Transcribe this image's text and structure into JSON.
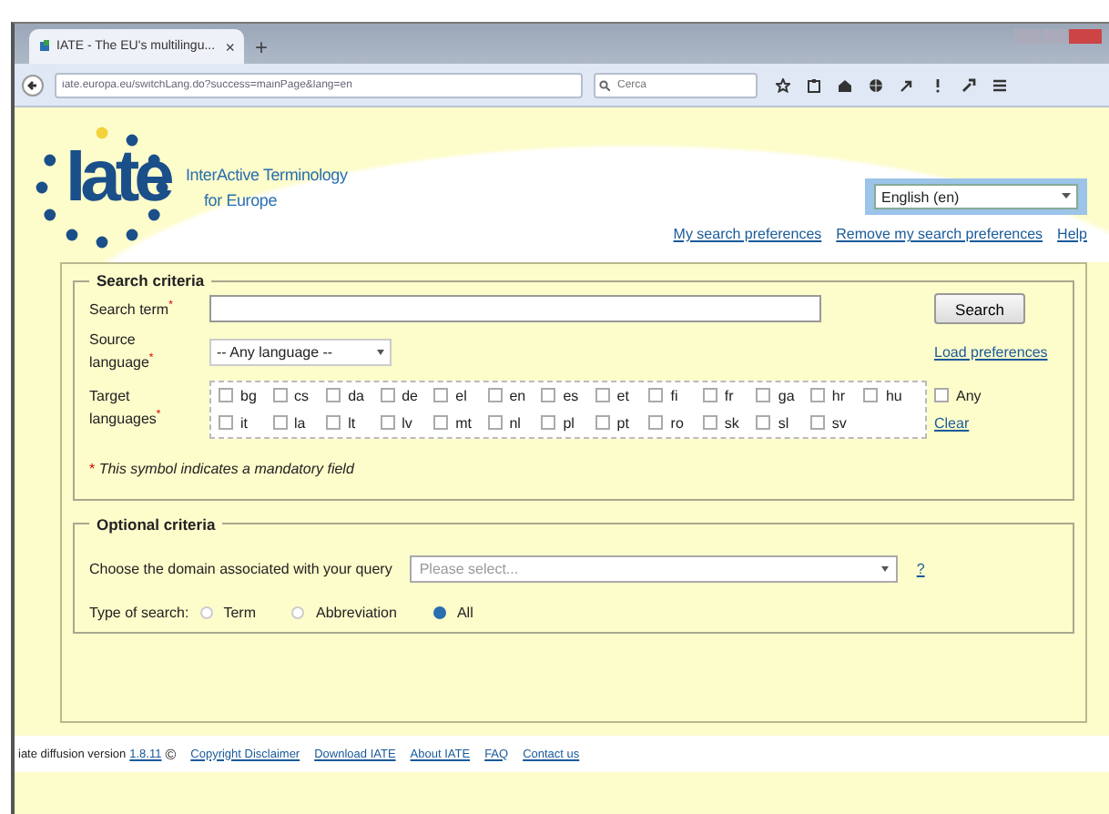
{
  "browser": {
    "tab_title": "IATE - The EU's multilingu...",
    "tab_close": "×",
    "new_tab": "+",
    "url": "iate.europa.eu/switchLang.do?success=mainPage&lang=en",
    "search_placeholder": "Cerca"
  },
  "header": {
    "logo_text": "Iate",
    "tagline_1": "InterActive Terminology",
    "tagline_2": "for Europe",
    "language": "English (en)",
    "links": [
      "My search preferences",
      "Remove my search preferences",
      "Help"
    ]
  },
  "search": {
    "legend": "Search criteria",
    "term_label": "Search term",
    "required_mark": "*",
    "search_button": "Search",
    "source_label": "Source language",
    "source_value": "-- Any language --",
    "load_link": "Load preferences",
    "target_label": "Target languages",
    "languages": [
      {
        "code": "bg",
        "checked": false
      },
      {
        "code": "cs",
        "checked": false
      },
      {
        "code": "da",
        "checked": false
      },
      {
        "code": "de",
        "checked": false
      },
      {
        "code": "el",
        "checked": false
      },
      {
        "code": "en",
        "checked": false
      },
      {
        "code": "es",
        "checked": false
      },
      {
        "code": "et",
        "checked": false
      },
      {
        "code": "fi",
        "checked": false
      },
      {
        "code": "fr",
        "checked": false
      },
      {
        "code": "ga",
        "checked": false
      },
      {
        "code": "hr",
        "checked": false
      },
      {
        "code": "hu",
        "checked": false
      },
      {
        "code": "it",
        "checked": false
      },
      {
        "code": "la",
        "checked": false
      },
      {
        "code": "lt",
        "checked": false
      },
      {
        "code": "lv",
        "checked": false
      },
      {
        "code": "mt",
        "checked": false
      },
      {
        "code": "nl",
        "checked": false
      },
      {
        "code": "pl",
        "checked": false
      },
      {
        "code": "pt",
        "checked": false
      },
      {
        "code": "ro",
        "checked": false
      },
      {
        "code": "sk",
        "checked": false
      },
      {
        "code": "sl",
        "checked": false
      },
      {
        "code": "sv",
        "checked": false
      }
    ],
    "any_label": "Any",
    "any_checked": false,
    "clear_link": "Clear",
    "note": "This symbol indicates a mandatory field"
  },
  "optional": {
    "legend": "Optional criteria",
    "domain_label": "Choose the domain associated with your query",
    "domain_placeholder": "Please select...",
    "help_link": "?",
    "type_label": "Type of search:",
    "types": [
      {
        "label": "Term",
        "selected": false
      },
      {
        "label": "Abbreviation",
        "selected": false
      },
      {
        "label": "All",
        "selected": true
      }
    ]
  },
  "footer": {
    "version_label": "iate diffusion version",
    "version": "1.8.11",
    "copyright": "©",
    "links": [
      "Copyright Disclaimer",
      "Download IATE",
      "About IATE",
      "FAQ",
      "Contact us"
    ]
  }
}
